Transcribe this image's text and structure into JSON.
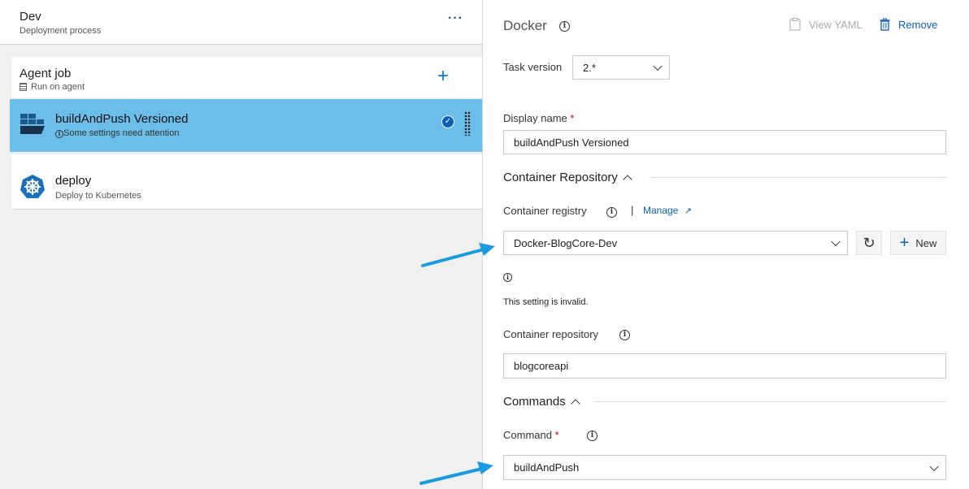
{
  "left": {
    "header": {
      "title": "Dev",
      "subtitle": "Deployment process",
      "more": "···"
    },
    "agent_job": {
      "title": "Agent job",
      "subtitle": "Run on agent"
    },
    "tasks": [
      {
        "title": "buildAndPush Versioned",
        "subtitle": "Some settings need attention",
        "selected": true
      },
      {
        "title": "deploy",
        "subtitle": "Deploy to Kubernetes"
      }
    ]
  },
  "right": {
    "title": "Docker",
    "toolbar": {
      "view_yaml": "View YAML",
      "remove": "Remove"
    },
    "task_version": {
      "label": "Task version",
      "value": "2.*"
    },
    "display_name": {
      "label": "Display name",
      "required": "*",
      "value": "buildAndPush Versioned"
    },
    "container_repository_section": {
      "label": "Container Repository"
    },
    "container_registry": {
      "label": "Container registry",
      "separator": "|",
      "manage": "Manage",
      "value": "Docker-BlogCore-Dev",
      "new": "New",
      "invalid": "This setting is invalid."
    },
    "container_repository": {
      "label": "Container repository",
      "value": "blogcoreapi"
    },
    "commands_section": {
      "label": "Commands"
    },
    "command": {
      "label": "Command",
      "required": "*",
      "value": "buildAndPush"
    }
  },
  "colors": {
    "accent": "#0a5fb4",
    "selected_row": "#6bbdea",
    "annotation_arrow": "#1a9be0"
  }
}
